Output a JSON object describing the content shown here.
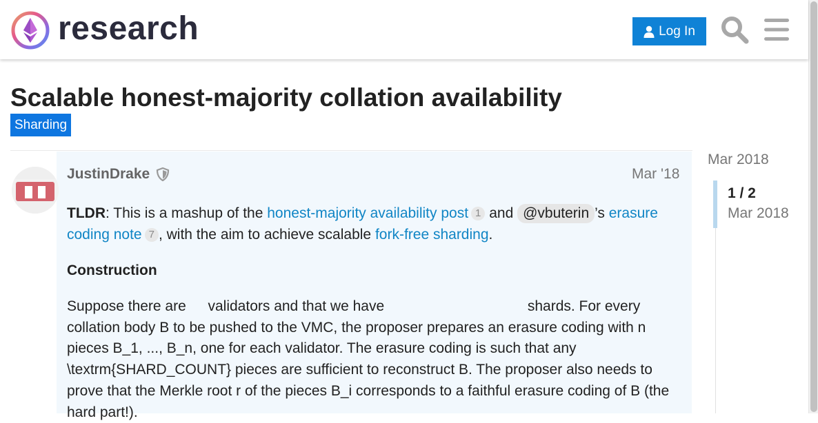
{
  "header": {
    "logo_text": "research",
    "login_label": "Log In"
  },
  "topic": {
    "title": "Scalable honest-majority collation availability",
    "category": "Sharding"
  },
  "post": {
    "username": "JustinDrake",
    "date": "Mar '18",
    "p1": {
      "lead": "TLDR",
      "t1": ": This is a mashup of the ",
      "link1": "honest-majority availability post",
      "link1_count": "1",
      "t2": " and ",
      "mention": "@vbuterin",
      "t3": "’s ",
      "link2": "erasure coding note",
      "link2_count": "7",
      "t4": ", with the aim to achieve scalable ",
      "link3": "fork-free sharding",
      "t5": "."
    },
    "heading": "Construction",
    "p2": {
      "a": "Suppose there are",
      "b": "validators and that we have",
      "c": "shards. For every collation body B to be pushed to the VMC, the proposer prepares an erasure coding with n pieces B_1, ..., B_n, one for each validator. The erasure coding is such that any \\textrm{SHARD_COUNT} pieces are sufficient to reconstruct B. The proposer also needs to prove that the Merkle root r of the pieces B_i corresponds to a faithful erasure coding of B (the hard part!)."
    }
  },
  "timeline": {
    "top_date": "Mar 2018",
    "position": "1 / 2",
    "position_date": "Mar 2018"
  },
  "colors": {
    "accent": "#0f82d6",
    "category": "#0e76e0",
    "link": "#1085c5",
    "post_bg": "#f2f8fd",
    "avatar": "#d4636d"
  }
}
